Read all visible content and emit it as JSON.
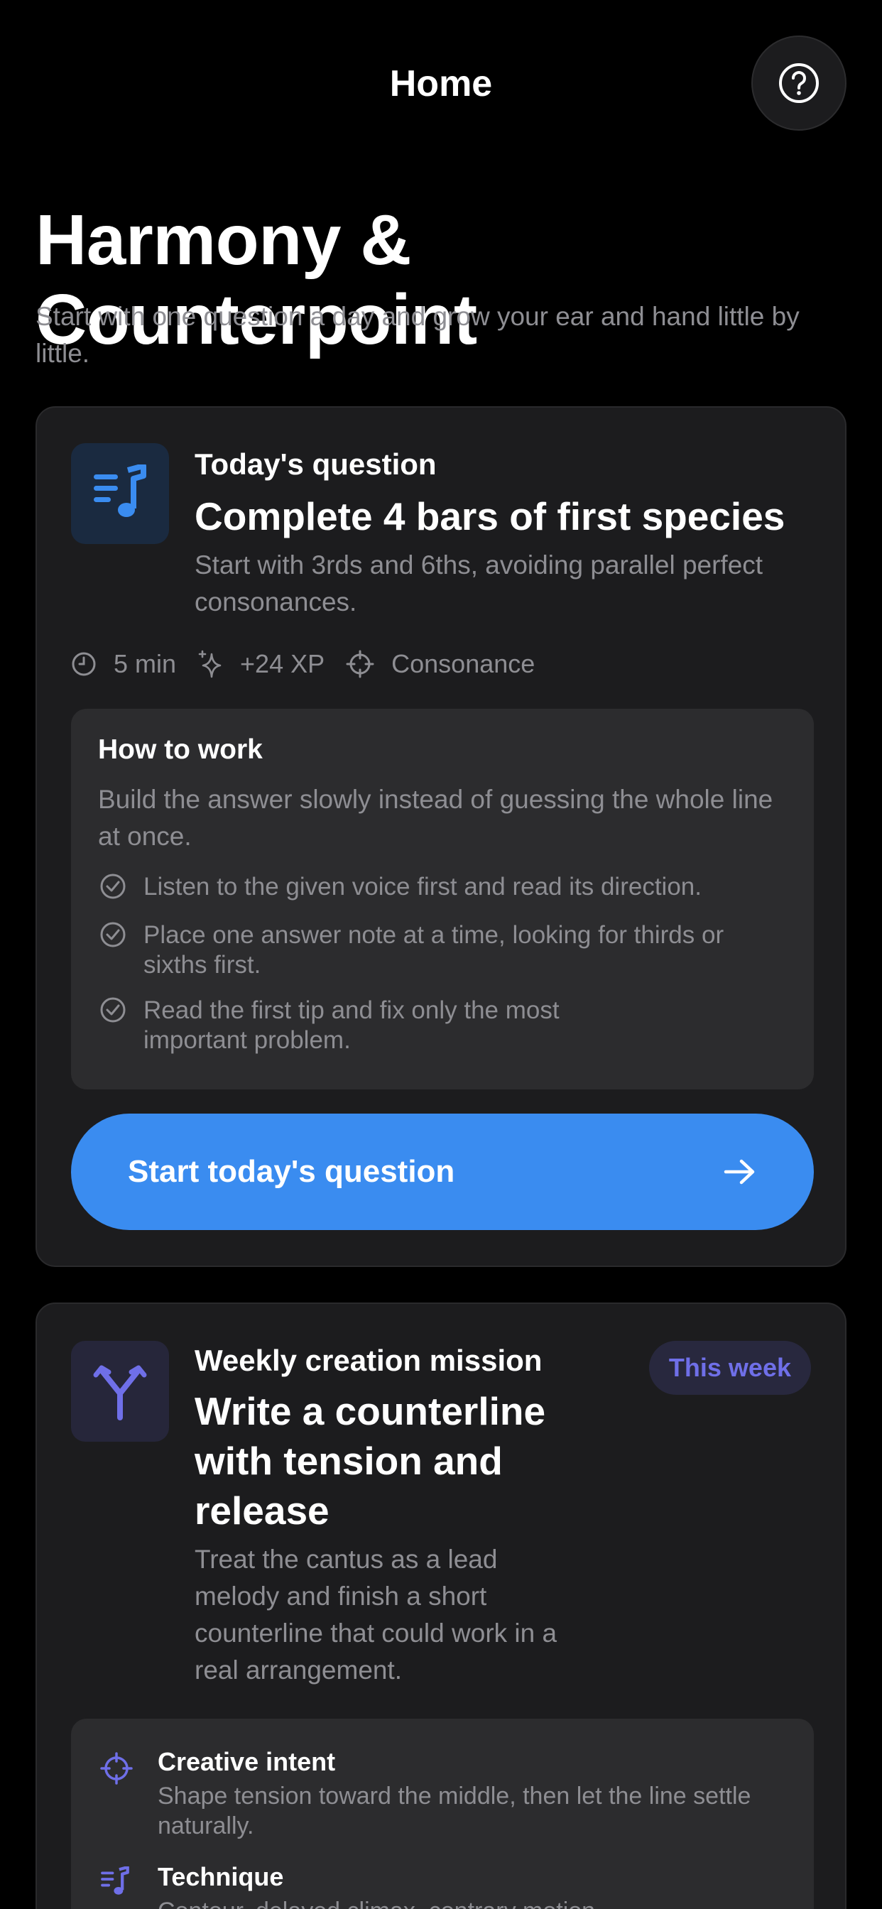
{
  "nav": {
    "title": "Home",
    "help_icon": "question-circle-icon"
  },
  "page": {
    "title": "Harmony & Counterpoint",
    "subtitle": "Start with one question a day and grow your ear and hand little by little."
  },
  "today": {
    "icon": "music-list-icon",
    "kicker": "Today's question",
    "heading": "Complete 4 bars of first species",
    "description": "Start with 3rds and 6ths, avoiding parallel perfect consonances.",
    "meta": [
      {
        "icon": "clock-icon",
        "text": "5 min"
      },
      {
        "icon": "sparkle-icon",
        "text": "+24 XP"
      },
      {
        "icon": "target-icon",
        "text": "Consonance"
      }
    ],
    "how_to": {
      "title": "How to work",
      "description": "Build the answer slowly instead of guessing the whole line at once.",
      "steps": [
        "Listen to the given voice first and read its direction.",
        "Place one answer note at a time, looking for thirds or sixths first.",
        "Read the first tip and fix only the most important problem."
      ]
    },
    "cta": {
      "label": "Start today's question",
      "icon": "arrow-right-icon"
    }
  },
  "weekly": {
    "icon": "split-arrows-icon",
    "kicker": "Weekly creation mission",
    "badge": "This week",
    "heading": "Write a counterline with tension and release",
    "description": "Treat the cantus as a lead melody and finish a short counterline that could work in a real arrangement.",
    "details": [
      {
        "icon": "target-icon",
        "title": "Creative intent",
        "text": "Shape tension toward the middle, then let the line settle naturally."
      },
      {
        "icon": "music-list-icon",
        "title": "Technique",
        "text": "Contour, delayed climax, contrary motion"
      }
    ]
  },
  "colors": {
    "accent": "#3a8cf0",
    "purple": "#6f6fe8",
    "card": "#1c1c1e",
    "muted": "#8e8e93"
  }
}
